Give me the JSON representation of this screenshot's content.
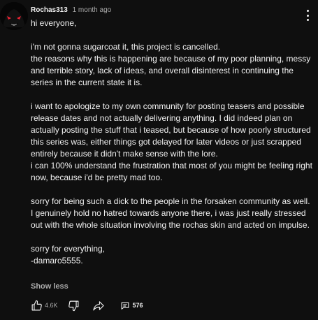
{
  "comment": {
    "author": "Rochas313",
    "timestamp": "1 month ago",
    "paragraphs": [
      [
        "hi everyone,"
      ],
      [
        "i'm not gonna sugarcoat it, this project is cancelled.",
        "the reasons why this is happening are because of my poor planning, messy and terrible story, lack of ideas, and overall disinterest in continuing the series in the current state it is."
      ],
      [
        "i want to apologize to my own community for posting teasers and possible release dates and not actually delivering anything. I did indeed plan on actually posting the stuff that i teased, but because of how poorly structured this series was, either things got delayed for later videos or just scrapped entirely because it didn't make sense with the lore.",
        "i can 100% understand the frustration that most of you might be feeling right now, because i'd be pretty mad too."
      ],
      [
        "sorry for being such a dick to the people in the forsaken community as well. I genuinely hold no hatred towards anyone there, i was just really stressed out with the whole situation involving the rochas skin and acted on impulse."
      ],
      [
        "sorry for everything,",
        "-damaro5555."
      ]
    ],
    "show_less_label": "Show less",
    "like_count": "4.6K",
    "reply_count": "576"
  },
  "icons": {
    "menu": "more-vertical-icon",
    "like": "thumbs-up-icon",
    "dislike": "thumbs-down-icon",
    "share": "share-arrow-icon",
    "replies": "comment-bubble-icon"
  },
  "colors": {
    "background": "#0f0f0f",
    "text": "#f1f1f1",
    "secondary_text": "#aaaaaa"
  }
}
